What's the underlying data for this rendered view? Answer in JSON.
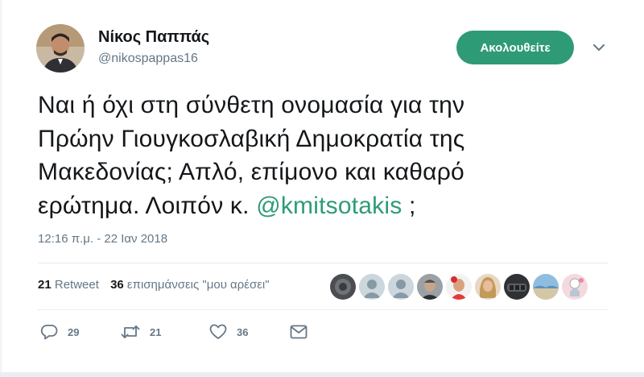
{
  "user": {
    "name": "Νίκος Παππάς",
    "handle": "@nikospappas16"
  },
  "follow_button": {
    "label": "Ακολουθείτε"
  },
  "tweet": {
    "lines": [
      "Ναι ή όχι στη σύνθετη ονομασία για την",
      "Πρώην Γιουγκοσλαβική Δημοκρατία της",
      "Μακεδονίας; Απλό, επίμονο και καθαρό"
    ],
    "last_line_prefix": "ερώτημα. Λοιπόν κ. ",
    "mention": "@kmitsotakis",
    "last_line_suffix": " ;",
    "timestamp": "12:16 π.μ. - 22 Ιαν 2018"
  },
  "stats": {
    "retweets_count": "21",
    "retweets_label": "Retweet",
    "likes_count": "36",
    "likes_label": "επισημάνσεις \"μου αρέσει\""
  },
  "actions": {
    "reply_count": "29",
    "retweet_count": "21",
    "like_count": "36"
  },
  "colors": {
    "accent": "#2e9b76",
    "secondary_text": "#657786",
    "primary_text": "#14171a"
  }
}
